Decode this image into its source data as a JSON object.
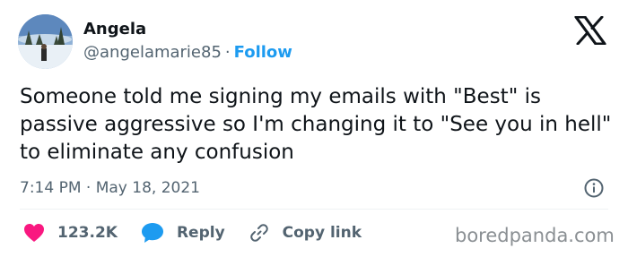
{
  "author": {
    "name": "Angela",
    "handle": "@angelamarie85",
    "separator": "·",
    "follow_label": "Follow"
  },
  "tweet": {
    "text": "Someone told me signing my emails with \"Best\" is passive aggressive so I'm changing it to \"See you in hell\" to eliminate any confusion",
    "time": "7:14 PM",
    "time_separator": "·",
    "date": "May 18, 2021"
  },
  "actions": {
    "likes_count": "123.2K",
    "reply_label": "Reply",
    "copy_link_label": "Copy link"
  },
  "icons": {
    "logo": "x-logo-icon",
    "like": "heart-icon",
    "reply": "speech-bubble-icon",
    "copy_link": "link-icon",
    "info": "info-icon"
  },
  "colors": {
    "accent": "#1d9bf0",
    "like": "#f91880",
    "muted": "#536471",
    "text": "#0f1419"
  },
  "watermark": "boredpanda.com"
}
